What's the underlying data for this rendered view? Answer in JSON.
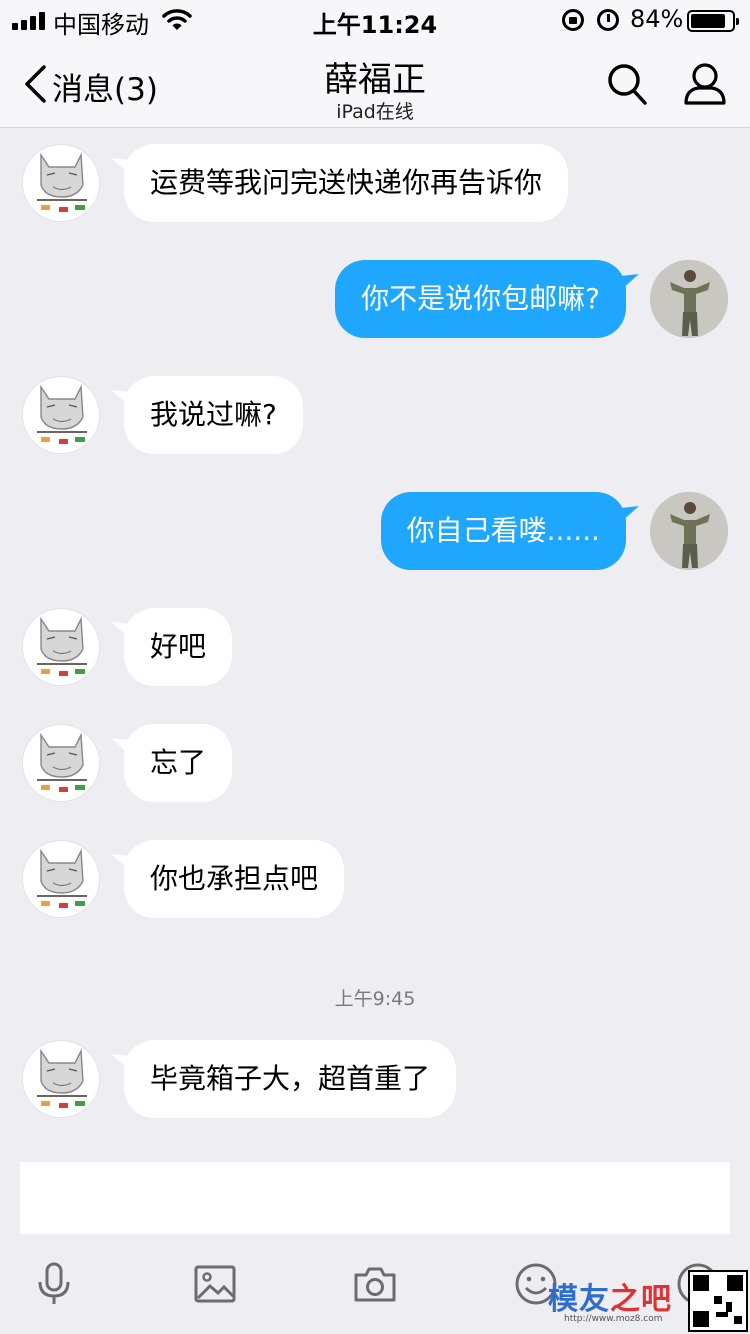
{
  "status_bar": {
    "carrier": "中国移动",
    "time": "上午11:24",
    "battery_percent": "84%",
    "battery_level": 0.84
  },
  "nav": {
    "back_label": "消息(3)",
    "title": "薛福正",
    "subtitle": "iPad在线"
  },
  "messages": [
    {
      "side": "left",
      "text": "运费等我问完送快递你再告诉你"
    },
    {
      "side": "right",
      "text": "你不是说你包邮嘛?"
    },
    {
      "side": "left",
      "text": "我说过嘛?"
    },
    {
      "side": "right",
      "text": "你自己看喽......"
    },
    {
      "side": "left",
      "text": "好吧"
    },
    {
      "side": "left",
      "text": "忘了"
    },
    {
      "side": "left",
      "text": "你也承担点吧"
    },
    {
      "side": "left",
      "text": "毕竟箱子大，超首重了"
    }
  ],
  "timestamp": "上午9:45",
  "toolbar": {
    "icons": [
      "microphone-icon",
      "image-icon",
      "camera-icon",
      "emoji-icon",
      "plus-icon"
    ]
  },
  "watermark": {
    "text_main": "模友",
    "text_accent": "之吧",
    "url": "http://www.moz8.com"
  },
  "colors": {
    "background": "#ededf2",
    "bubble_sent": "#1ea7fd",
    "bubble_received": "#ffffff"
  }
}
